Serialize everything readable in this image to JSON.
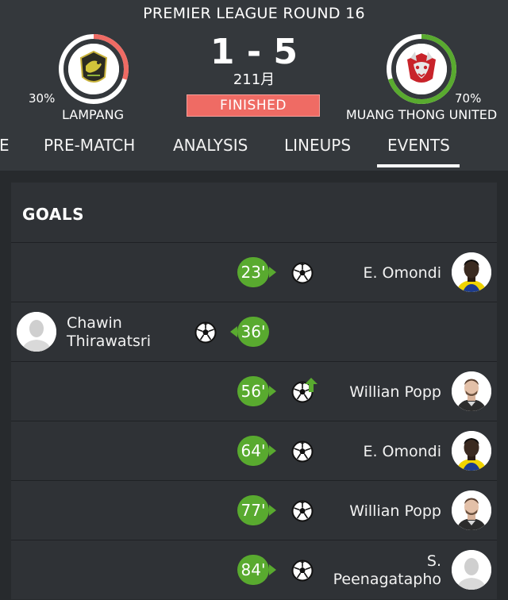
{
  "match": {
    "round_title": "PREMIER LEAGUE ROUND 16",
    "score": "1 - 5",
    "date": "211月",
    "status": "FINISHED",
    "status_color": "#ef6b64"
  },
  "home": {
    "name": "LAMPANG",
    "possession_label": "30%",
    "possession": 0.3,
    "ring_color": "#ef6b64"
  },
  "away": {
    "name": "MUANG THONG UNITED",
    "possession_label": "70%",
    "possession": 0.7,
    "ring_color": "#59aa2f"
  },
  "tabs": [
    "E",
    "PRE-MATCH",
    "ANALYSIS",
    "LINEUPS",
    "EVENTS"
  ],
  "active_tab": "EVENTS",
  "events": {
    "section_title": "GOALS",
    "accent": "#59aa2f",
    "goals": [
      {
        "minute": "23'",
        "side": "away",
        "player": "E. Omondi",
        "type": "goal"
      },
      {
        "minute": "36'",
        "side": "home",
        "player_line1": "Chawin",
        "player_line2": "Thirawatsri",
        "type": "goal"
      },
      {
        "minute": "56'",
        "side": "away",
        "player": "Willian Popp",
        "type": "goal-assist"
      },
      {
        "minute": "64'",
        "side": "away",
        "player": "E. Omondi",
        "type": "goal"
      },
      {
        "minute": "77'",
        "side": "away",
        "player": "Willian Popp",
        "type": "goal"
      },
      {
        "minute": "84'",
        "side": "away",
        "player_line1": "S.",
        "player_line2": "Peenagatapho",
        "type": "goal"
      }
    ]
  },
  "icons": {
    "goal": "soccer-ball-icon",
    "assist": "up-arrow-icon",
    "avatar": "player-avatar"
  }
}
